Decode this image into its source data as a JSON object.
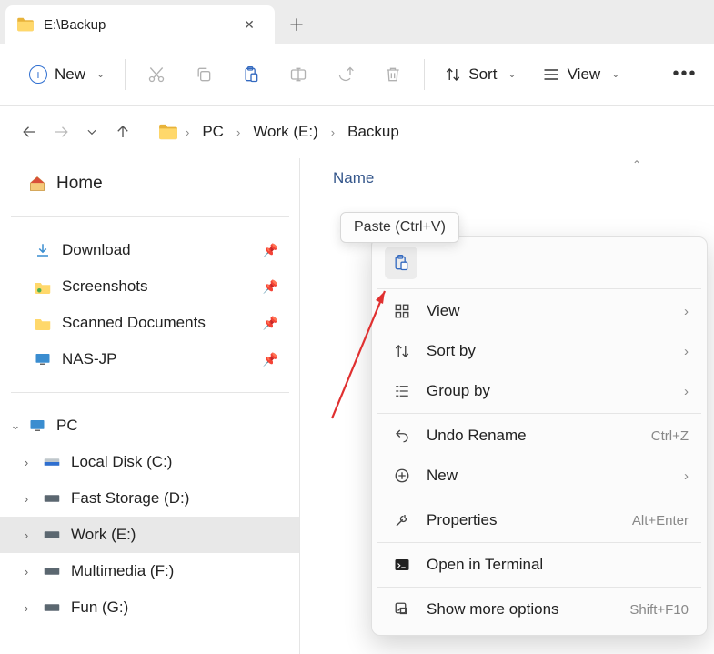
{
  "tab": {
    "title": "E:\\Backup"
  },
  "toolbar": {
    "new_label": "New",
    "sort_label": "Sort",
    "view_label": "View"
  },
  "breadcrumb": {
    "seg0": "PC",
    "seg1": "Work (E:)",
    "seg2": "Backup"
  },
  "sidebar": {
    "home": "Home",
    "quick": {
      "i0": "Download",
      "i1": "Screenshots",
      "i2": "Scanned Documents",
      "i3": "NAS-JP"
    },
    "pc": {
      "label": "PC",
      "d0": "Local Disk (C:)",
      "d1": "Fast Storage (D:)",
      "d2": "Work (E:)",
      "d3": "Multimedia (F:)",
      "d4": "Fun (G:)"
    }
  },
  "content": {
    "col_name": "Name"
  },
  "tooltip": "Paste (Ctrl+V)",
  "context_menu": {
    "view": "View",
    "sort_by": "Sort by",
    "group_by": "Group by",
    "undo": "Undo Rename",
    "undo_sc": "Ctrl+Z",
    "new": "New",
    "properties": "Properties",
    "properties_sc": "Alt+Enter",
    "open_terminal": "Open in Terminal",
    "more_options": "Show more options",
    "more_options_sc": "Shift+F10"
  }
}
